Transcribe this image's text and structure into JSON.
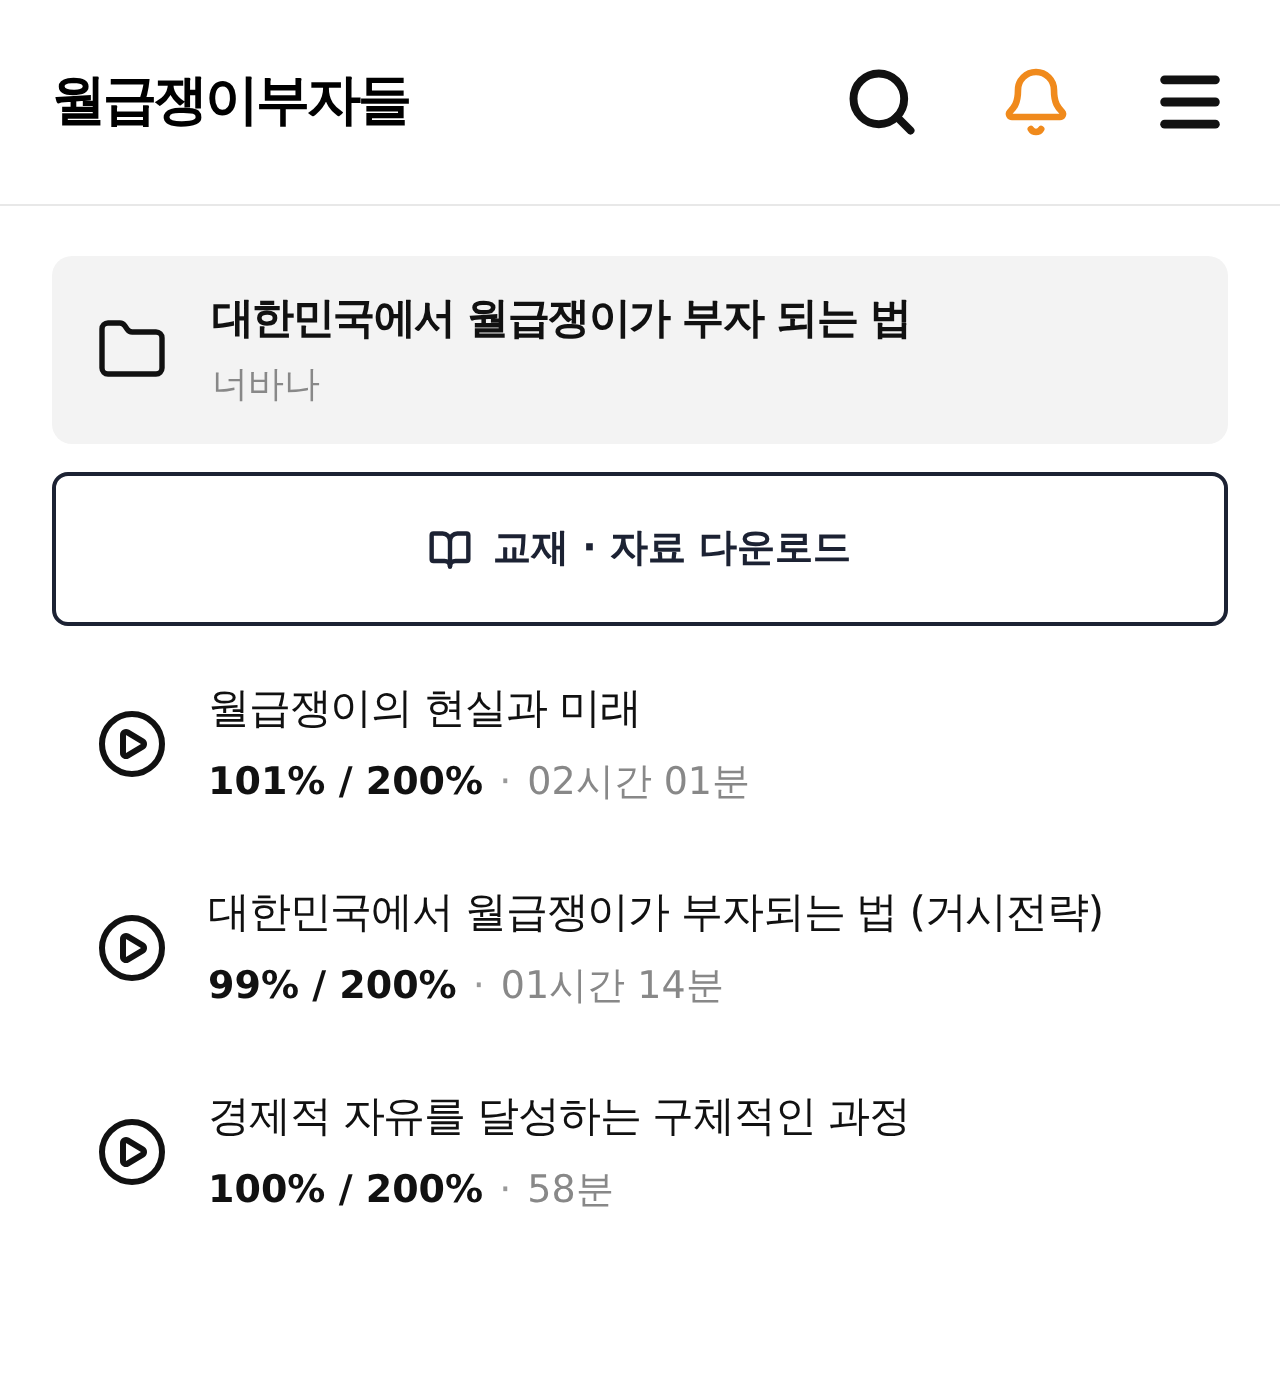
{
  "header": {
    "title": "월급쟁이부자들",
    "notification_active": true
  },
  "course": {
    "title": "대한민국에서 월급쟁이가 부자 되는 법",
    "author": "너바나"
  },
  "download_button": {
    "label": "교재 · 자료 다운로드"
  },
  "lessons": [
    {
      "title": "월급쟁이의 현실과 미래",
      "progress": "101% / 200%",
      "separator": "·",
      "duration": "02시간 01분"
    },
    {
      "title": "대한민국에서 월급쟁이가 부자되는 법 (거시전략)",
      "progress": "99% / 200%",
      "separator": "·",
      "duration": "01시간 14분"
    },
    {
      "title": "경제적 자유를 달성하는 구체적인 과정",
      "progress": "100% / 200%",
      "separator": "·",
      "duration": "58분"
    }
  ]
}
